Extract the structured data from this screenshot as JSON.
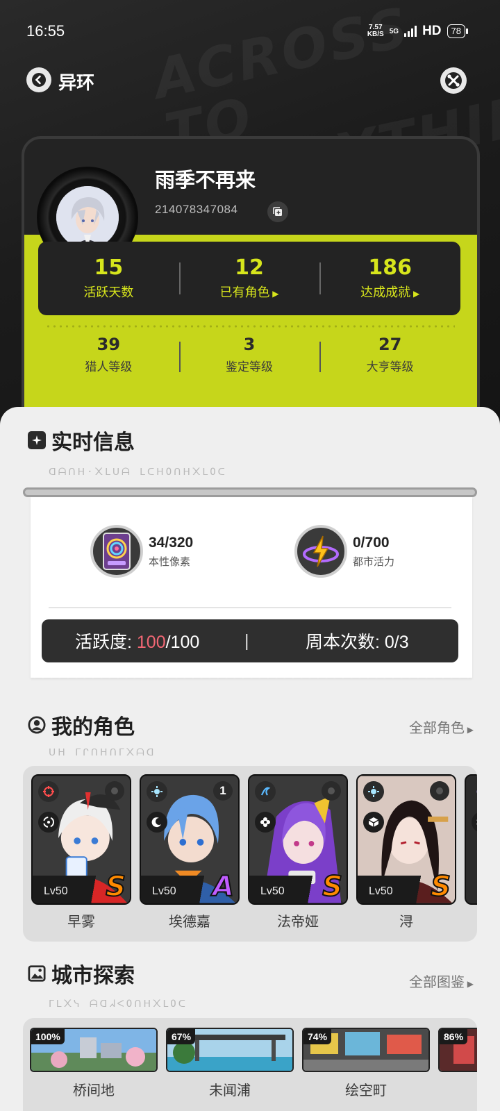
{
  "status_bar": {
    "time": "16:55",
    "net_speed_value": "7.57",
    "net_speed_unit": "KB/S",
    "network": "5G",
    "hd": "HD",
    "battery": "78"
  },
  "header": {
    "title": "异环"
  },
  "profile": {
    "nickname": "雨季不再来",
    "uid": "214078347084",
    "stats": [
      {
        "value": "15",
        "label": "活跃天数"
      },
      {
        "value": "12",
        "label": "已有角色"
      },
      {
        "value": "186",
        "label": "达成成就"
      }
    ],
    "levels": [
      {
        "value": "39",
        "label": "猎人等级"
      },
      {
        "value": "3",
        "label": "鉴定等级"
      },
      {
        "value": "27",
        "label": "大亨等级"
      }
    ]
  },
  "realtime": {
    "title": "实时信息",
    "subtitle": "ᗡᗩᑎᕼ·᙭ᒪᑌᗩ ᒪᑕᕼOᑎᕼ᙭ᒪOᑕ",
    "resources": [
      {
        "value": "34/320",
        "label": "本性像素",
        "icon": "pixel-card-icon"
      },
      {
        "value": "0/700",
        "label": "都市活力",
        "icon": "lightning-orb-icon"
      }
    ],
    "activity_label": "活跃度:",
    "activity_current": "100",
    "activity_total": "/100",
    "separator": "|",
    "weekly_label": "周本次数:",
    "weekly_value": "0/3"
  },
  "characters": {
    "title": "我的角色",
    "subtitle": "ᑌᕼ ᒥᒋᑎᕼᑎᒥ᙭ᗩᗡ",
    "more": "全部角色",
    "list": [
      {
        "name": "早雾",
        "level": "Lv50",
        "rank": "S",
        "badge": ""
      },
      {
        "name": "埃德嘉",
        "level": "Lv50",
        "rank": "A",
        "badge": "1"
      },
      {
        "name": "法帝娅",
        "level": "Lv50",
        "rank": "S",
        "badge": ""
      },
      {
        "name": "浔",
        "level": "Lv50",
        "rank": "S",
        "badge": ""
      }
    ],
    "accent": "#ff8a00"
  },
  "city": {
    "title": "城市探索",
    "subtitle": "ᒥᒪ᙭ᓭ ᗩᗡᖽᐸOᑎᕼ᙭ᒪOᑕ",
    "more": "全部图鉴",
    "list": [
      {
        "name": "桥间地",
        "percent": "100%"
      },
      {
        "name": "未闻浦",
        "percent": "67%"
      },
      {
        "name": "绘空町",
        "percent": "74%"
      },
      {
        "name": "",
        "percent": "86%"
      }
    ]
  },
  "colors": {
    "lime": "#c6d61b",
    "highlight_red": "#f26774",
    "rank_s": "#ff8a00",
    "rank_a": "#c05cff"
  }
}
